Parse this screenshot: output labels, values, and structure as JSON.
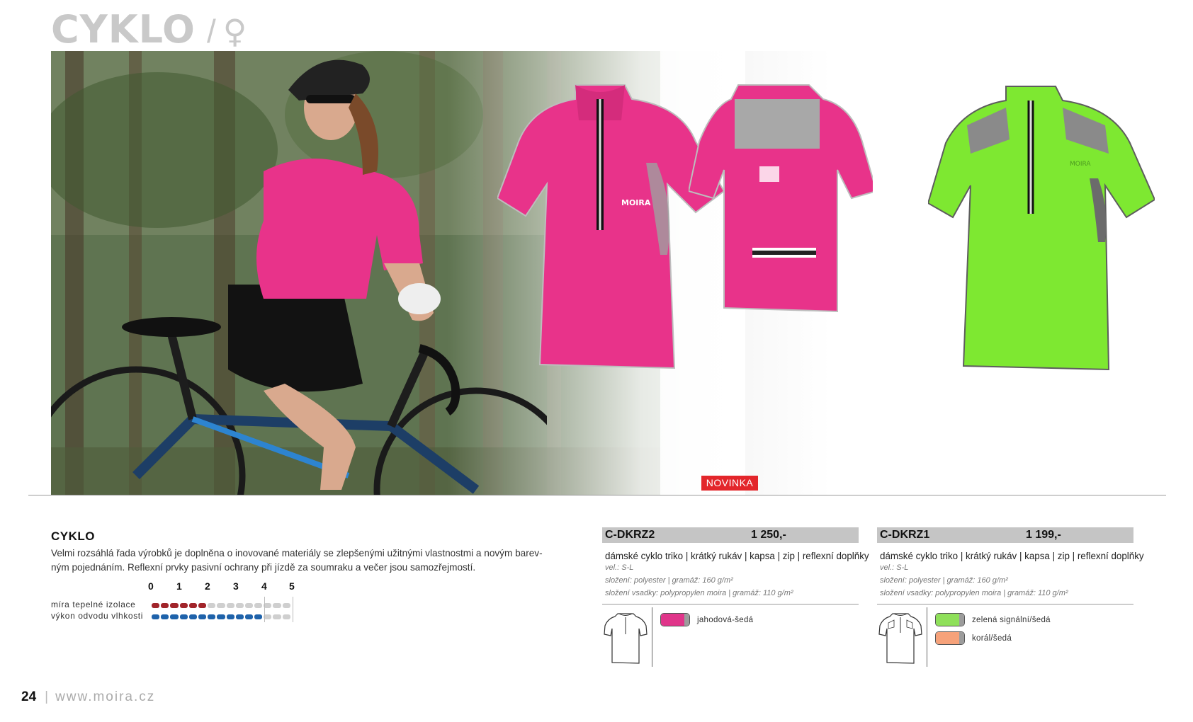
{
  "header": {
    "title": "CYKLO",
    "separator": "/",
    "symbol": "♀"
  },
  "hero": {
    "badge": "NOVINKA"
  },
  "section": {
    "title": "CYKLO",
    "description": "Velmi rozsáhlá řada výrobků je doplněna o inovované materiály se zlepšenými užitnými vlastnostmi a novým barev-ným pojednáním. Reflexní prvky pasivní ochrany při jízdě za soumraku a večer jsou samozřejmostí."
  },
  "scale": {
    "numbers": [
      "0",
      "1",
      "2",
      "3",
      "4",
      "5"
    ],
    "rows": [
      {
        "label": "míra tepelné izolace",
        "level": 2,
        "color": "#a1242a"
      },
      {
        "label": "výkon odvodu vlhkosti",
        "level": 4,
        "color": "#1e62aa"
      }
    ]
  },
  "products": [
    {
      "code": "C-DKRZ2",
      "price": "1 250,-",
      "description": "dámské cyklo triko | krátký rukáv | kapsa | zip | reflexní doplňky",
      "size": "vel.: S-L",
      "composition": "složení: polyester | gramáž: 160 g/m²",
      "insert": "složení vsadky: polypropylen moira | gramáž: 110 g/m²",
      "colors": [
        {
          "name": "jahodová-šedá",
          "hex": "#e0358a"
        }
      ]
    },
    {
      "code": "C-DKRZ1",
      "price": "1 199,-",
      "description": "dámské cyklo triko | krátký rukáv | kapsa | zip | reflexní doplňky",
      "size": "vel.: S-L",
      "composition": "složení: polyester | gramáž: 160 g/m²",
      "insert": "složení vsadky: polypropylen moira | gramáž: 110 g/m²",
      "colors": [
        {
          "name": "zelená signální/šedá",
          "hex": "#8fe05a"
        },
        {
          "name": "korál/šedá",
          "hex": "#f6a27a"
        }
      ]
    }
  ],
  "footer": {
    "page_number": "24",
    "website": "www.moira.cz"
  },
  "palette": {
    "pink_jersey": "#e8338a",
    "green_jersey": "#7ee831",
    "accent_red": "#e3262b"
  }
}
